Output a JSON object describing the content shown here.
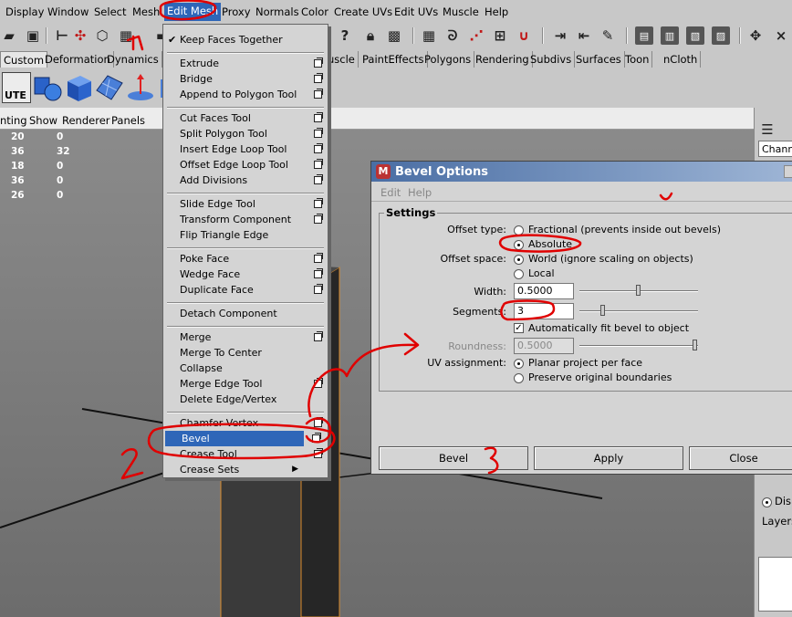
{
  "menubar": {
    "items": [
      "Display",
      "Window",
      "Select",
      "Mesh",
      "Edit Mesh",
      "Proxy",
      "Normals",
      "Color",
      "Create UVs",
      "Edit UVs",
      "Muscle",
      "Help"
    ],
    "active": "Edit Mesh"
  },
  "shelf": {
    "tabs": [
      "Custom",
      "Deformation",
      "Dynamics",
      "uscle",
      "PaintEffects",
      "Polygons",
      "Rendering",
      "Subdivs",
      "Surfaces",
      "Toon",
      "nCloth"
    ],
    "active_tab": "Custom",
    "first_icon_label": "UTE"
  },
  "viewport": {
    "menu": [
      "nting",
      "Show",
      "Renderer",
      "Panels"
    ],
    "hud_rows": [
      [
        "20",
        "0"
      ],
      [
        "36",
        "32"
      ],
      [
        "18",
        "0"
      ],
      [
        "36",
        "0"
      ],
      [
        "26",
        "0"
      ]
    ]
  },
  "channelbox": {
    "tab_label": "Channe",
    "display_label": "Disp",
    "layers_label": "Layers"
  },
  "dropdown": {
    "items": [
      {
        "label": "Keep Faces Together",
        "checked": true,
        "option": false
      },
      {
        "label": "Extrude",
        "option": true
      },
      {
        "label": "Bridge",
        "option": true
      },
      {
        "label": "Append to Polygon Tool",
        "option": true
      },
      {
        "label": "Cut Faces Tool",
        "option": true
      },
      {
        "label": "Split Polygon Tool",
        "option": true
      },
      {
        "label": "Insert Edge Loop Tool",
        "option": true
      },
      {
        "label": "Offset Edge Loop Tool",
        "option": true
      },
      {
        "label": "Add Divisions",
        "option": true
      },
      {
        "label": "Slide Edge Tool",
        "option": true
      },
      {
        "label": "Transform Component",
        "option": true
      },
      {
        "label": "Flip Triangle Edge",
        "option": false
      },
      {
        "label": "Poke Face",
        "option": true
      },
      {
        "label": "Wedge Face",
        "option": true
      },
      {
        "label": "Duplicate Face",
        "option": true
      },
      {
        "label": "Detach Component",
        "option": false
      },
      {
        "label": "Merge",
        "option": true
      },
      {
        "label": "Merge To Center",
        "option": false
      },
      {
        "label": "Collapse",
        "option": false
      },
      {
        "label": "Merge Edge Tool",
        "option": true
      },
      {
        "label": "Delete Edge/Vertex",
        "option": false
      },
      {
        "label": "Chamfer Vertex",
        "option": true
      },
      {
        "label": "Bevel",
        "option": true,
        "highlighted": true
      },
      {
        "label": "Crease Tool",
        "option": true
      },
      {
        "label": "Crease Sets",
        "submenu": true
      }
    ]
  },
  "dialog": {
    "title": "Bevel Options",
    "menu": [
      "Edit",
      "Help"
    ],
    "settings_title": "Settings",
    "offset_type_label": "Offset type:",
    "offset_type_options": [
      "Fractional (prevents inside out bevels)",
      "Absolute"
    ],
    "offset_type_selected": "Absolute",
    "offset_space_label": "Offset space:",
    "offset_space_options": [
      "World (ignore scaling on objects)",
      "Local"
    ],
    "offset_space_selected": "World (ignore scaling on objects)",
    "width_label": "Width:",
    "width_value": "0.5000",
    "width_slider_fraction": 0.5,
    "segments_label": "Segments:",
    "segments_value": "3",
    "segments_slider_fraction": 0.2,
    "autofit_label": "Automatically fit bevel to object",
    "autofit_checked": true,
    "roundness_label": "Roundness:",
    "roundness_value": "0.5000",
    "uv_label": "UV assignment:",
    "uv_options": [
      "Planar project per face",
      "Preserve original boundaries"
    ],
    "uv_selected": "Planar project per face",
    "buttons": {
      "bevel": "Bevel",
      "apply": "Apply",
      "close": "Close"
    }
  },
  "annotations": {
    "color": "#e00000",
    "marks": [
      "1",
      "2",
      "3"
    ]
  },
  "colors": {
    "menu_highlight": "#2e66b8",
    "viewport_bg": "#7c7c7c"
  }
}
